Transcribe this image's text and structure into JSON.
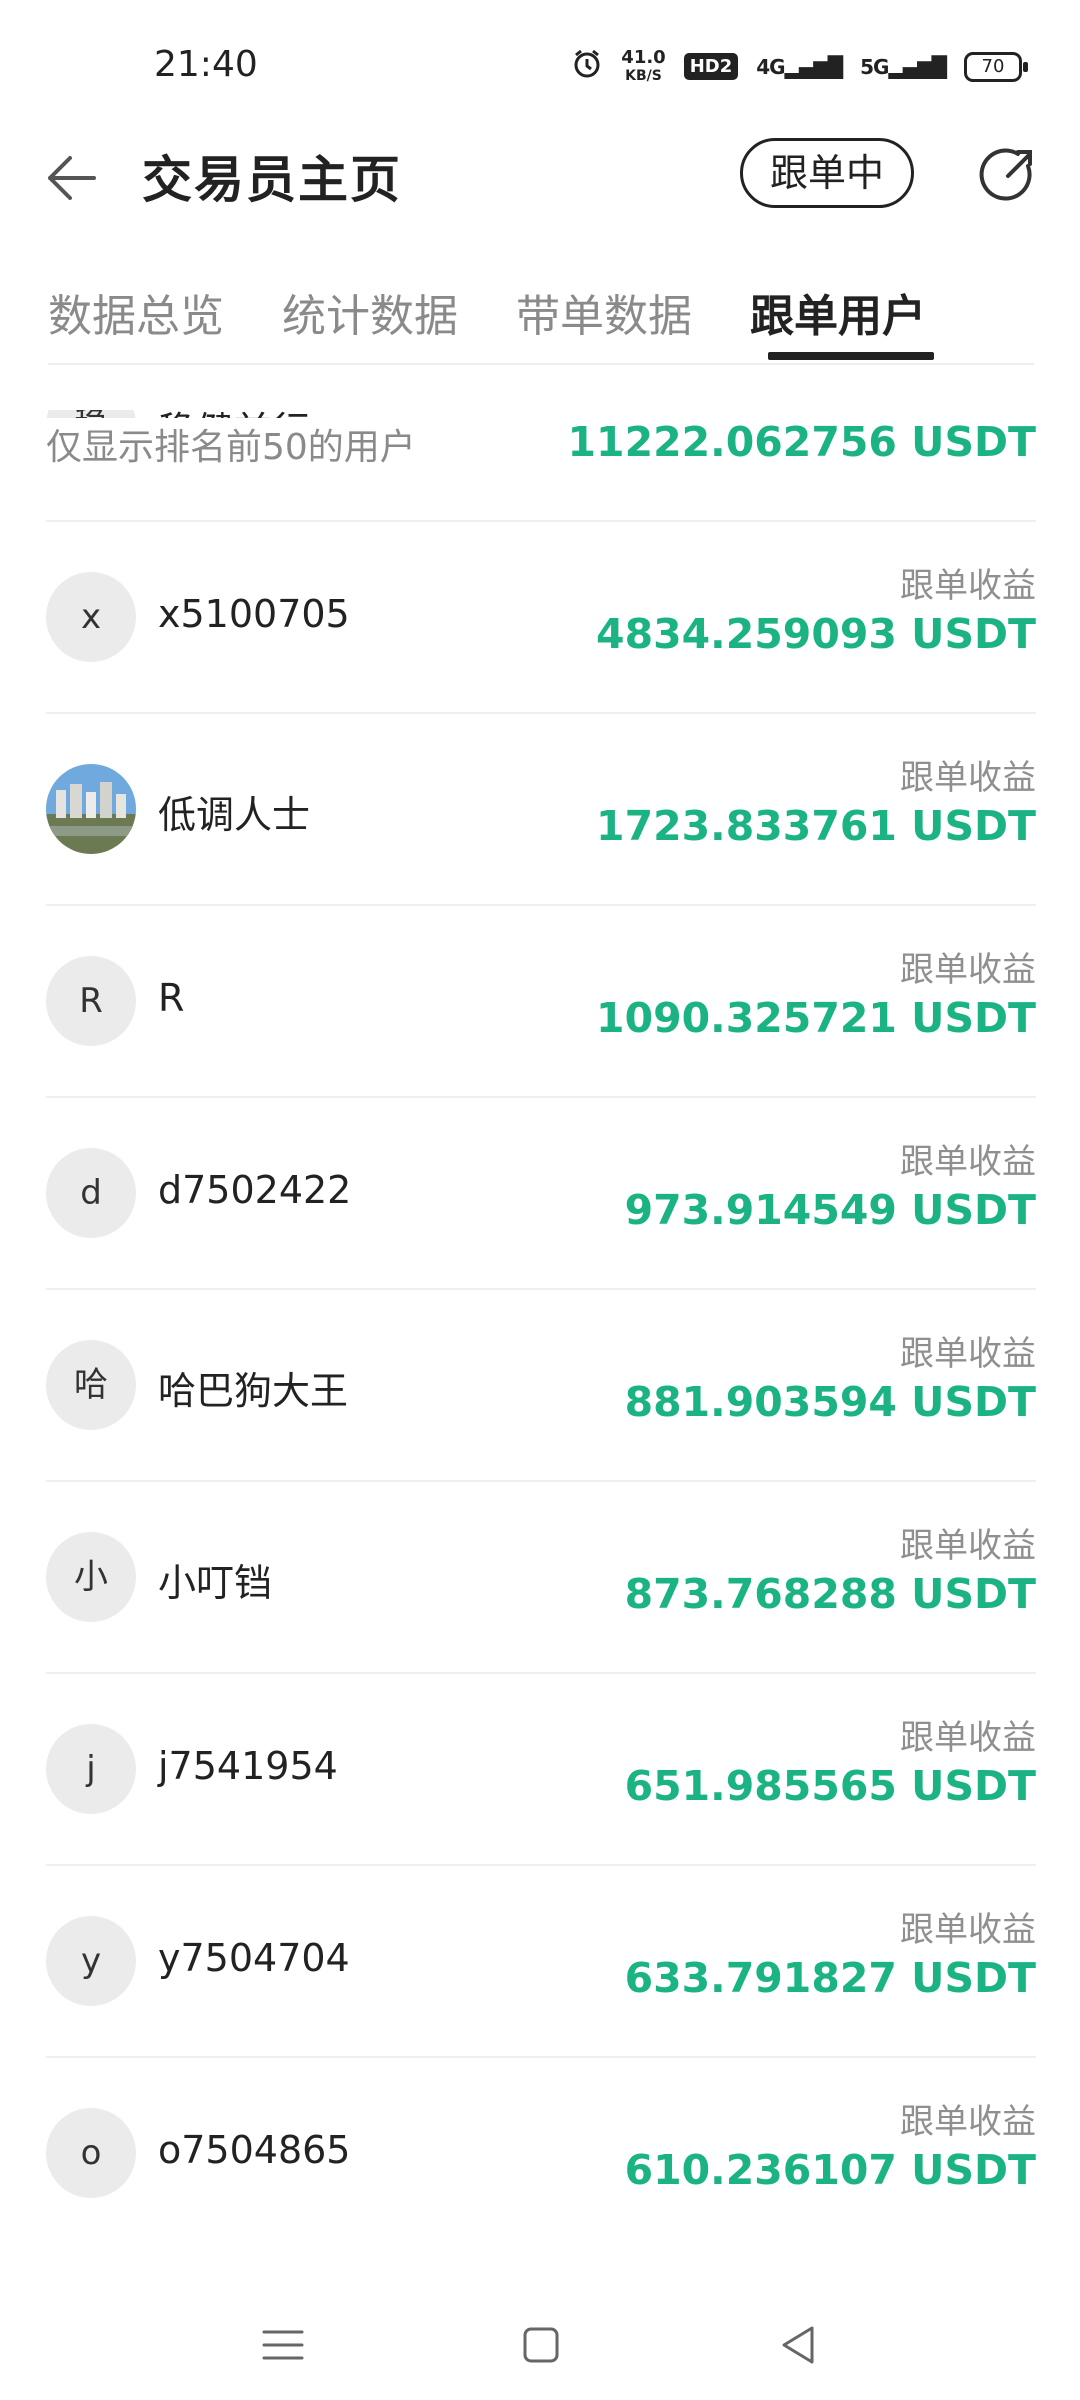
{
  "status_bar": {
    "time": "21:40",
    "net_speed_value": "41.0",
    "net_speed_unit": "KB/S",
    "hd_label": "HD2",
    "signal_1": "4G",
    "signal_2": "5G",
    "battery": "70",
    "icons": [
      "alarm-icon",
      "hd-icon",
      "signal-4g-icon",
      "signal-5g-icon",
      "battery-icon"
    ]
  },
  "header": {
    "title": "交易员主页",
    "follow_button": "跟单中",
    "back_icon": "arrow-left-icon",
    "share_icon": "share-icon"
  },
  "tabs": [
    {
      "label": "数据总览",
      "active": false
    },
    {
      "label": "统计数据",
      "active": false
    },
    {
      "label": "带单数据",
      "active": false
    },
    {
      "label": "跟单用户",
      "active": true
    }
  ],
  "note": "仅显示排名前50的用户",
  "earnings_label": "跟单收益",
  "users": [
    {
      "avatar": "稳",
      "name": "稳健前行",
      "amount": "11222.062756 USDT"
    },
    {
      "avatar": "x",
      "name": "x5100705",
      "amount": "4834.259093 USDT"
    },
    {
      "avatar": "",
      "avatar_photo": true,
      "name": "低调人士",
      "amount": "1723.833761 USDT"
    },
    {
      "avatar": "R",
      "name": "R",
      "amount": "1090.325721 USDT"
    },
    {
      "avatar": "d",
      "name": "d7502422",
      "amount": "973.914549 USDT"
    },
    {
      "avatar": "哈",
      "name": "哈巴狗大王",
      "amount": "881.903594 USDT"
    },
    {
      "avatar": "小",
      "name": "小叮铛",
      "amount": "873.768288 USDT"
    },
    {
      "avatar": "j",
      "name": "j7541954",
      "amount": "651.985565 USDT"
    },
    {
      "avatar": "y",
      "name": "y7504704",
      "amount": "633.791827 USDT"
    },
    {
      "avatar": "o",
      "name": "o7504865",
      "amount": "610.236107 USDT"
    }
  ],
  "colors": {
    "accent_green": "#1bb383",
    "text_primary": "#222222",
    "text_secondary": "#8a8a8a"
  },
  "nav": [
    "menu-icon",
    "home-icon",
    "back-triangle-icon"
  ]
}
